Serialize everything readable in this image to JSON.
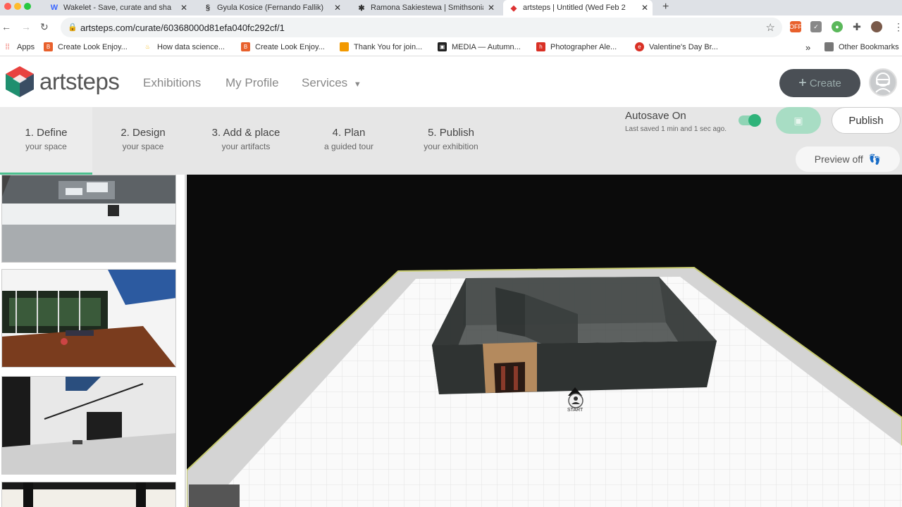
{
  "browser": {
    "tabs": [
      {
        "title": "Wakelet - Save, curate and sha",
        "favicon": "W"
      },
      {
        "title": "Gyula Kosice (Fernando Fallik)",
        "favicon": "§"
      },
      {
        "title": "Ramona Sakiestewa | Smithsonia",
        "favicon": "✱"
      },
      {
        "title": "artsteps | Untitled (Wed Feb 2",
        "favicon": "◆"
      }
    ],
    "new_tab": "+",
    "url": "artsteps.com/curate/60368000d81efa040fc292cf/1",
    "bookmarks": [
      {
        "label": "Apps",
        "color": "#e94235"
      },
      {
        "label": "Create Look Enjoy...",
        "color": "#e8602c"
      },
      {
        "label": "How data science...",
        "color": "#f6b400"
      },
      {
        "label": "Create Look Enjoy...",
        "color": "#e8602c"
      },
      {
        "label": "Thank You for join...",
        "color": "#f29900"
      },
      {
        "label": "MEDIA — Autumn...",
        "color": "#222222"
      },
      {
        "label": "Photographer Ale...",
        "color": "#d93025"
      },
      {
        "label": "Valentine's Day Br...",
        "color": "#d93025"
      }
    ],
    "more_bookmarks": "»",
    "other_bookmarks": "Other Bookmarks"
  },
  "app": {
    "logo_text": "artsteps",
    "nav": [
      "Exhibitions",
      "My Profile",
      "Services"
    ],
    "create_label": "Create",
    "steps": [
      {
        "title": "1. Define",
        "sub": "your space"
      },
      {
        "title": "2. Design",
        "sub": "your space"
      },
      {
        "title": "3. Add & place",
        "sub": "your artifacts"
      },
      {
        "title": "4. Plan",
        "sub": "a guided tour"
      },
      {
        "title": "5. Publish",
        "sub": "your exhibition"
      }
    ],
    "autosave_label": "Autosave On",
    "last_saved": "Last saved 1 min and 1 sec ago.",
    "publish_label": "Publish",
    "preview_label": "Preview off",
    "start_marker": "START"
  },
  "colors": {
    "accent_green": "#2fb37a",
    "create_button": "#4a4f55"
  }
}
